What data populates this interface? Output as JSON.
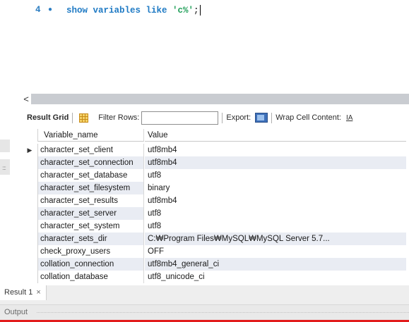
{
  "editor": {
    "line_number": "4",
    "code_keyword": "show variables like ",
    "code_string": "'c%'",
    "code_terminator": ";"
  },
  "toolbar": {
    "result_grid_label": "Result Grid",
    "filter_rows_label": "Filter Rows:",
    "filter_rows_value": "",
    "export_label": "Export:",
    "wrap_cell_label": "Wrap Cell Content:",
    "wrap_icon_glyph": "IA"
  },
  "table": {
    "columns": [
      "Variable_name",
      "Value"
    ],
    "rows": [
      {
        "name": "character_set_client",
        "value": "utf8mb4"
      },
      {
        "name": "character_set_connection",
        "value": "utf8mb4"
      },
      {
        "name": "character_set_database",
        "value": "utf8"
      },
      {
        "name": "character_set_filesystem",
        "value": "binary"
      },
      {
        "name": "character_set_results",
        "value": "utf8mb4"
      },
      {
        "name": "character_set_server",
        "value": "utf8"
      },
      {
        "name": "character_set_system",
        "value": "utf8"
      },
      {
        "name": "character_sets_dir",
        "value": "C:₩Program Files₩MySQL₩MySQL Server 5.7..."
      },
      {
        "name": "check_proxy_users",
        "value": "OFF"
      },
      {
        "name": "collation_connection",
        "value": "utf8mb4_general_ci"
      },
      {
        "name": "collation_database",
        "value": "utf8_unicode_ci"
      }
    ],
    "current_row_marker": "▶"
  },
  "bottom": {
    "result_tab_label": "Result 1",
    "result_tab_close": "×",
    "output_label": "Output"
  },
  "scroll": {
    "left_arrow": "<"
  }
}
